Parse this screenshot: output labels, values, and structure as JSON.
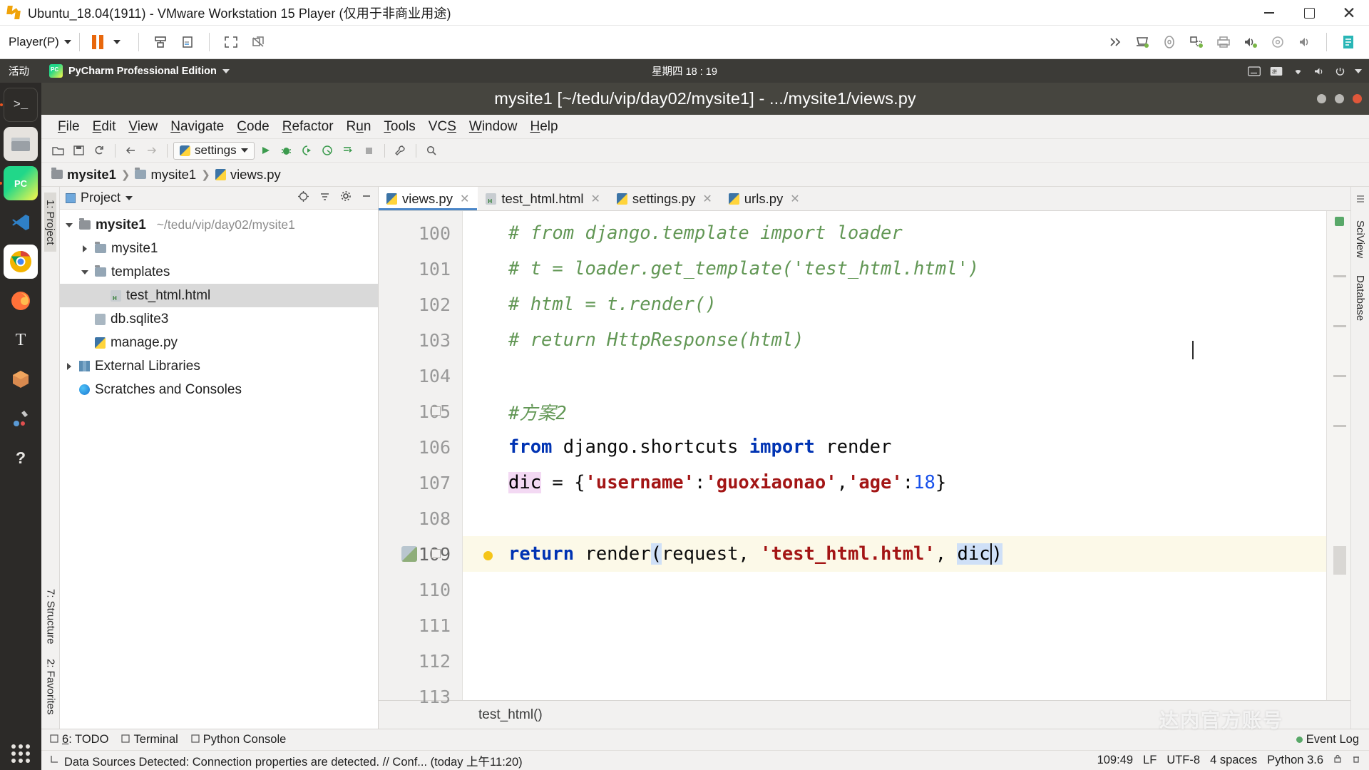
{
  "vmware": {
    "title": "Ubuntu_18.04(1911) - VMware Workstation 15 Player (仅用于非商业用途)",
    "player_menu": "Player(P)",
    "icons": [
      "vmware-logo-icon",
      "pause-icon",
      "dropdown-arrow-icon",
      "usb-icon",
      "cd-icon",
      "fullscreen-icon",
      "unity-icon"
    ],
    "right_icons": [
      "chevron-double-right-icon",
      "removable-device-icon",
      "cd-drive-icon",
      "network-adapter-icon",
      "printer-icon",
      "sound-out-icon",
      "disc-icon",
      "speaker-icon",
      "sidebar-icon"
    ],
    "window_controls": [
      "minimize",
      "maximize",
      "close"
    ]
  },
  "ubuntu": {
    "activities": "活动",
    "app_name": "PyCharm Professional Edition",
    "clock": "星期四 18 : 19",
    "tray_icons": [
      "keyboard-icon",
      "input-method-icon",
      "network-icon",
      "volume-icon",
      "power-icon",
      "dropdown-arrow-icon"
    ],
    "launcher_items": [
      {
        "name": "terminal",
        "label": "Terminal"
      },
      {
        "name": "files",
        "label": "Files"
      },
      {
        "name": "pycharm",
        "label": "PyCharm"
      },
      {
        "name": "vscode",
        "label": "Visual Studio Code"
      },
      {
        "name": "chrome",
        "label": "Google Chrome"
      },
      {
        "name": "firefox",
        "label": "Firefox"
      },
      {
        "name": "text-editor",
        "label": "Text Editor"
      },
      {
        "name": "ubuntu-software",
        "label": "Ubuntu Software"
      },
      {
        "name": "tools",
        "label": "Tools"
      },
      {
        "name": "help",
        "label": "Help"
      }
    ]
  },
  "pycharm": {
    "title": "mysite1 [~/tedu/vip/day02/mysite1] - .../mysite1/views.py",
    "menu": [
      {
        "pre": "",
        "u": "F",
        "post": "ile"
      },
      {
        "pre": "",
        "u": "E",
        "post": "dit"
      },
      {
        "pre": "",
        "u": "V",
        "post": "iew"
      },
      {
        "pre": "",
        "u": "N",
        "post": "avigate"
      },
      {
        "pre": "",
        "u": "C",
        "post": "ode"
      },
      {
        "pre": "",
        "u": "R",
        "post": "efactor"
      },
      {
        "pre": "R",
        "u": "u",
        "post": "n"
      },
      {
        "pre": "",
        "u": "T",
        "post": "ools"
      },
      {
        "pre": "VC",
        "u": "S",
        "post": ""
      },
      {
        "pre": "",
        "u": "W",
        "post": "indow"
      },
      {
        "pre": "",
        "u": "H",
        "post": "elp"
      }
    ],
    "toolbar": {
      "run_config": "settings",
      "icons": [
        "open-folder-icon",
        "save-icon",
        "sync-icon",
        "back-arrow-icon",
        "forward-arrow-icon",
        "run-icon",
        "debug-icon",
        "run-coverage-icon",
        "profile-icon",
        "run-with-console-icon",
        "stop-icon",
        "wrench-icon",
        "search-icon"
      ]
    },
    "breadcrumb": [
      {
        "label": "mysite1",
        "icon": "folder-icon",
        "bold": true
      },
      {
        "label": "mysite1",
        "icon": "folder-icon",
        "bold": false
      },
      {
        "label": "views.py",
        "icon": "python-file-icon",
        "bold": false
      }
    ],
    "project_panel": {
      "title": "Project",
      "header_icons": [
        "target-icon",
        "collapse-all-icon",
        "settings-gear-icon",
        "hide-icon"
      ],
      "tree": [
        {
          "label": "mysite1",
          "path": "~/tedu/vip/day02/mysite1",
          "icon": "folder-icon",
          "twisty": "down",
          "indent": 0,
          "bold": true,
          "selected": false
        },
        {
          "label": "mysite1",
          "path": "",
          "icon": "folder-blue-icon",
          "twisty": "right",
          "indent": 1,
          "bold": false,
          "selected": false
        },
        {
          "label": "templates",
          "path": "",
          "icon": "folder-blue-icon",
          "twisty": "down",
          "indent": 1,
          "bold": false,
          "selected": false
        },
        {
          "label": "test_html.html",
          "path": "",
          "icon": "html-file-icon",
          "twisty": "none",
          "indent": 2,
          "bold": false,
          "selected": true
        },
        {
          "label": "db.sqlite3",
          "path": "",
          "icon": "db-file-icon",
          "twisty": "none",
          "indent": 1,
          "bold": false,
          "selected": false
        },
        {
          "label": "manage.py",
          "path": "",
          "icon": "python-file-icon",
          "twisty": "none",
          "indent": 1,
          "bold": false,
          "selected": false
        },
        {
          "label": "External Libraries",
          "path": "",
          "icon": "library-icon",
          "twisty": "right",
          "indent": 0,
          "bold": false,
          "selected": false
        },
        {
          "label": "Scratches and Consoles",
          "path": "",
          "icon": "scratch-icon",
          "twisty": "none",
          "indent": 0,
          "bold": false,
          "selected": false
        }
      ]
    },
    "left_strips": [
      "1: Project",
      "7: Structure",
      "2: Favorites"
    ],
    "right_strips": [
      "SciView",
      "Database"
    ],
    "editor_tabs": [
      {
        "label": "views.py",
        "icon": "python-file-icon",
        "active": true,
        "closable": true
      },
      {
        "label": "test_html.html",
        "icon": "html-file-icon",
        "active": false,
        "closable": true
      },
      {
        "label": "settings.py",
        "icon": "python-file-icon",
        "active": false,
        "closable": true
      },
      {
        "label": "urls.py",
        "icon": "python-file-icon",
        "active": false,
        "closable": true
      }
    ],
    "code": {
      "first_line": 100,
      "lines": [
        {
          "n": 100,
          "tokens": [
            {
              "t": "# from django.template import loader",
              "c": "cmt"
            }
          ],
          "indent": 1,
          "highlight": false
        },
        {
          "n": 101,
          "tokens": [
            {
              "t": "# t = loader.get_template('test_html.html')",
              "c": "cmt"
            }
          ],
          "indent": 1,
          "highlight": false
        },
        {
          "n": 102,
          "tokens": [
            {
              "t": "# html = t.render()",
              "c": "cmt"
            }
          ],
          "indent": 1,
          "highlight": false
        },
        {
          "n": 103,
          "tokens": [
            {
              "t": "# return HttpResponse(html)",
              "c": "cmt"
            }
          ],
          "indent": 1,
          "highlight": false
        },
        {
          "n": 104,
          "tokens": [],
          "indent": 1,
          "highlight": false
        },
        {
          "n": 105,
          "tokens": [
            {
              "t": "#方案2",
              "c": "cmt"
            }
          ],
          "indent": 1,
          "highlight": false
        },
        {
          "n": 106,
          "tokens": [
            {
              "t": "from",
              "c": "kw"
            },
            {
              "t": " django.shortcuts ",
              "c": "plain"
            },
            {
              "t": "import",
              "c": "kw"
            },
            {
              "t": " render",
              "c": "plain"
            }
          ],
          "indent": 1,
          "highlight": false
        },
        {
          "n": 107,
          "tokens": [
            {
              "t": "dic",
              "c": "dic-hl"
            },
            {
              "t": " = {",
              "c": "plain"
            },
            {
              "t": "'username'",
              "c": "str"
            },
            {
              "t": ":",
              "c": "plain"
            },
            {
              "t": "'guoxiaonao'",
              "c": "str"
            },
            {
              "t": ",",
              "c": "plain"
            },
            {
              "t": "'age'",
              "c": "str"
            },
            {
              "t": ":",
              "c": "plain"
            },
            {
              "t": "18",
              "c": "num"
            },
            {
              "t": "}",
              "c": "plain"
            }
          ],
          "indent": 1,
          "highlight": false
        },
        {
          "n": 108,
          "tokens": [],
          "indent": 1,
          "highlight": false
        },
        {
          "n": 109,
          "tokens": [
            {
              "t": "return",
              "c": "kw"
            },
            {
              "t": " render",
              "c": "plain"
            },
            {
              "t": "(",
              "c": "paren-hl"
            },
            {
              "t": "request, ",
              "c": "plain"
            },
            {
              "t": "'test_html.html'",
              "c": "str"
            },
            {
              "t": ", ",
              "c": "plain"
            },
            {
              "t": "dic",
              "c": "dic-hl2"
            },
            {
              "t": ")",
              "c": "paren-hl"
            }
          ],
          "indent": 1,
          "highlight": true
        },
        {
          "n": 110,
          "tokens": [],
          "indent": 0,
          "highlight": false
        },
        {
          "n": 111,
          "tokens": [],
          "indent": 0,
          "highlight": false
        },
        {
          "n": 112,
          "tokens": [],
          "indent": 0,
          "highlight": false
        },
        {
          "n": 113,
          "tokens": [],
          "indent": 0,
          "highlight": false
        }
      ]
    },
    "editor_breadcrumb": "test_html()",
    "bottom_tabs": [
      {
        "label_pre": "",
        "label_u": "6",
        "label_post": ": TODO",
        "icon": "todo-icon"
      },
      {
        "label_pre": "Terminal",
        "label_u": "",
        "label_post": "",
        "icon": "terminal-icon"
      },
      {
        "label_pre": "Python Console",
        "label_u": "",
        "label_post": "",
        "icon": "python-console-icon"
      }
    ],
    "event_log": "Event Log",
    "status_message": "Data Sources Detected: Connection properties are detected. // Conf... (today 上午11:20)",
    "status_right": [
      "109:49",
      "LF",
      "UTF-8",
      "4 spaces",
      "Python 3.6"
    ],
    "watermark": "达内官方账号"
  },
  "colors": {
    "accent_blue": "#4a86c8",
    "comment_green": "#629755",
    "keyword_blue": "#0033b3",
    "string_red": "#a31515",
    "number_blue": "#1750eb",
    "highlight_yellow": "#fcf9e8",
    "ubuntu_panel": "#3c3b37",
    "pycharm_title_bg": "#46453f",
    "vmware_orange": "#f0a30a"
  }
}
